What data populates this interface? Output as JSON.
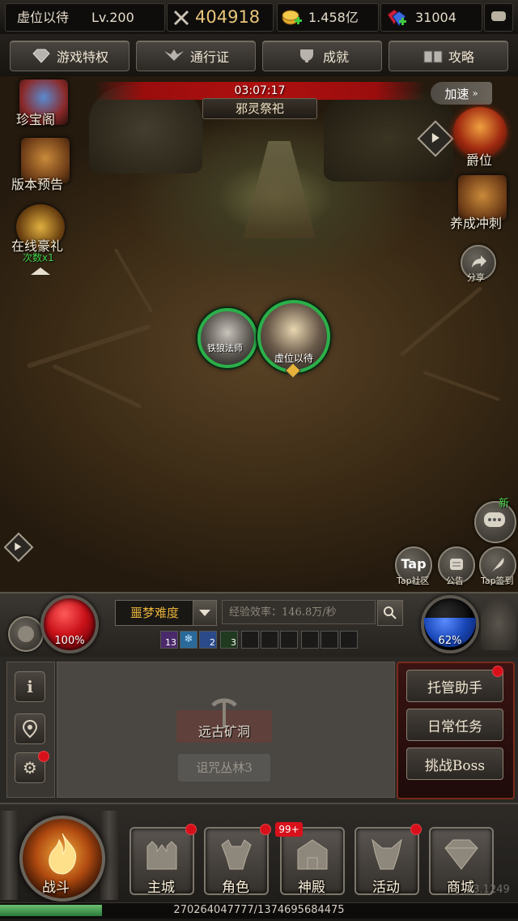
{
  "status": {
    "player_name": "虚位以待",
    "level": "Lv.200",
    "combat_power": "404918",
    "gold": "1.458亿",
    "gems": "31004"
  },
  "menu": [
    {
      "label": "游戏特权",
      "icon": "diamond-icon"
    },
    {
      "label": "通行证",
      "icon": "wings-icon"
    },
    {
      "label": "成就",
      "icon": "trophy-icon"
    },
    {
      "label": "攻略",
      "icon": "book-icon"
    }
  ],
  "event": {
    "timer": "03:07:17",
    "name": "邪灵祭祀"
  },
  "speed_button": "加速",
  "left_icons": {
    "treasure": "珍宝阁",
    "preview": "版本预告",
    "online_gift": "在线豪礼",
    "online_gift_sub": "次数x1"
  },
  "right_icons": {
    "rank": "爵位",
    "growth": "养成冲刺",
    "share": "分享"
  },
  "characters": {
    "companion": "铁狼法师",
    "player": "虚位以待"
  },
  "social": {
    "new_badge": "新",
    "tap_logo": "Tap",
    "tap_community": "Tap社区",
    "notice": "公告",
    "tap_checkin": "Tap签到"
  },
  "control": {
    "hp_percent": "100%",
    "mp_percent": "62%",
    "difficulty": "噩梦难度",
    "exp_rate": "经验效率：146.8万/秒",
    "buffs": [
      "13",
      "",
      "2",
      "3"
    ]
  },
  "map": {
    "current": "远古矿洞",
    "sub": "诅咒丛林3"
  },
  "tasks": [
    "托管助手",
    "日常任务",
    "挑战Boss"
  ],
  "nav": {
    "battle": "战斗",
    "items": [
      {
        "label": "主城",
        "icon": "castle-icon"
      },
      {
        "label": "角色",
        "icon": "helmet-icon"
      },
      {
        "label": "神殿",
        "icon": "temple-icon"
      },
      {
        "label": "活动",
        "icon": "demon-icon"
      },
      {
        "label": "商城",
        "icon": "gem-icon"
      }
    ],
    "temple_badge": "99+"
  },
  "exp_bar": {
    "text": "270264047777/1374695684475",
    "fill_fraction": 0.197
  },
  "version": "23.1249",
  "colors": {
    "hp": "#c81018",
    "mp": "#1a48b8",
    "frame_green": "#2bb04a",
    "difficulty_gold": "#e6b23a",
    "badge_red": "#d8101a"
  }
}
